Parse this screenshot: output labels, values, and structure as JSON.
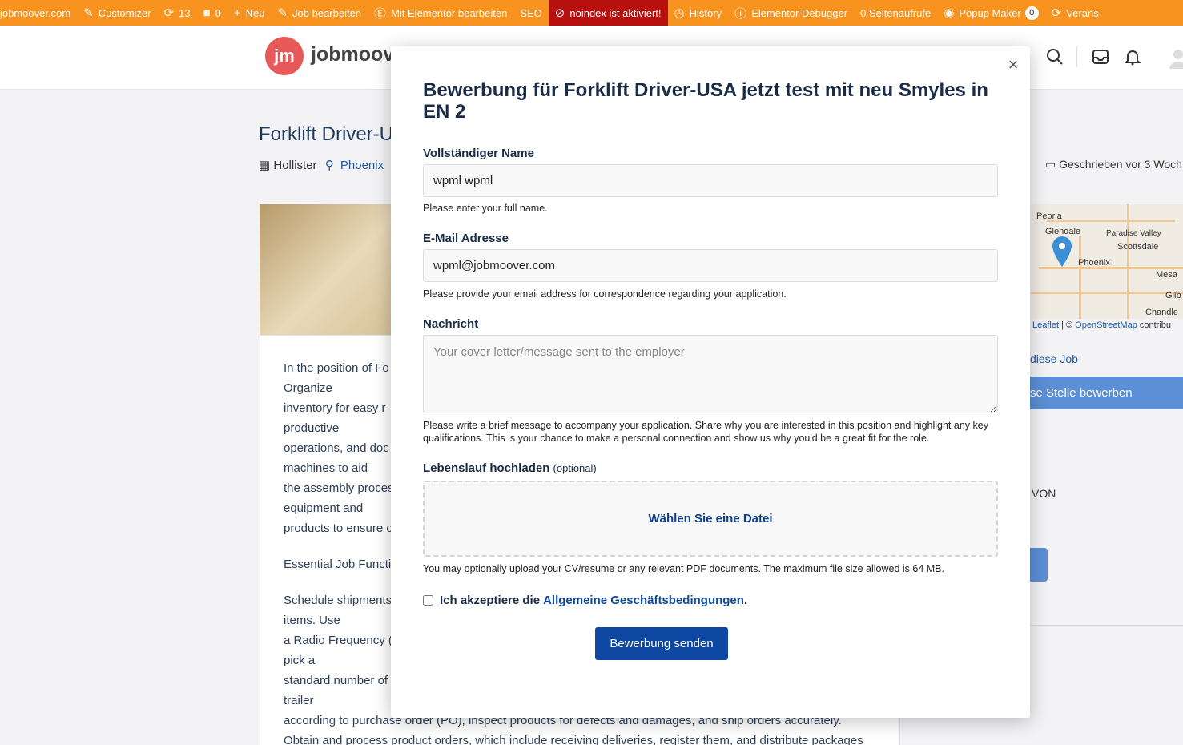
{
  "adminbar": {
    "items": [
      {
        "icon": "",
        "label": "jobmoover.com"
      },
      {
        "icon": "✎",
        "label": "Customizer"
      },
      {
        "icon": "⟳",
        "label": "13"
      },
      {
        "icon": "■",
        "label": "0"
      },
      {
        "icon": "+",
        "label": "Neu"
      },
      {
        "icon": "✎",
        "label": "Job bearbeiten"
      },
      {
        "icon": "Ⓔ",
        "label": "Mit Elementor bearbeiten"
      },
      {
        "icon": "",
        "label": "SEO"
      },
      {
        "icon": "⊘",
        "label": "noindex ist aktiviert!"
      },
      {
        "icon": "◷",
        "label": "History"
      },
      {
        "icon": "ⓘ",
        "label": "Elementor Debugger"
      },
      {
        "icon": "",
        "label": "0 Seitenaufrufe"
      },
      {
        "icon": "◉",
        "label": "Popup Maker",
        "badge": "0"
      },
      {
        "icon": "⟳",
        "label": "Verans"
      }
    ]
  },
  "header": {
    "logo_initials": "jm",
    "logo_text": "jobmoov"
  },
  "job": {
    "title": "Forklift Driver-U",
    "company": "Hollister",
    "location": "Phoenix",
    "posted": "Geschrieben vor 3 Woch",
    "lines": [
      "In the position of Fo",
      "Organize",
      "inventory for easy r",
      "productive",
      "operations, and doc",
      "machines to aid",
      "the assembly proces",
      "equipment and",
      "products to ensure c",
      "",
      "Essential Job Functi",
      "",
      "Schedule shipments",
      "items. Use",
      "a Radio Frequency (",
      "pick a",
      "standard number of",
      "trailer",
      "according to purchase order (PO), inspect products for defects and damages, and ship orders accurately.",
      "Obtain and process product orders, which include receiving deliveries, register them, and distribute packages"
    ]
  },
  "map": {
    "labels": [
      "Peoria",
      "Glendale",
      "Paradise Valley",
      "Scottsdale",
      "Phoenix",
      "Mesa",
      "Gilb",
      "Chandle"
    ],
    "credit_leaflet": "Leaflet",
    "credit_sep": " | © ",
    "credit_osm": "OpenStreetMap",
    "credit_rest": " contribu"
  },
  "sidebar": {
    "link": "diese Job",
    "apply": "se Stelle bewerben",
    "von": "VON"
  },
  "modal": {
    "close": "×",
    "title": "Bewerbung für Forklift Driver-USA jetzt test mit neu Smyles in EN 2",
    "name_label": "Vollständiger Name",
    "name_value": "wpml wpml",
    "name_help": "Please enter your full name.",
    "email_label": "E-Mail Adresse",
    "email_value": "wpml@jobmoover.com",
    "email_help": "Please provide your email address for correspondence regarding your application.",
    "message_label": "Nachricht",
    "message_placeholder": "Your cover letter/message sent to the employer",
    "message_help": "Please write a brief message to accompany your application. Share why you are interested in this position and highlight any key qualifications. This is your chance to make a personal connection and show us why you'd be a great fit for the role.",
    "cv_label": "Lebenslauf hochladen",
    "cv_optional": "(optional)",
    "cv_button": "Wählen Sie eine Datei",
    "cv_help": "You may optionally upload your CV/resume or any relevant PDF documents. The maximum file size allowed is 64 MB.",
    "terms_prefix": "Ich akzeptiere die",
    "terms_link": "Allgemeine Geschäftsbedingungen",
    "terms_suffix": ".",
    "submit": "Bewerbung senden"
  }
}
